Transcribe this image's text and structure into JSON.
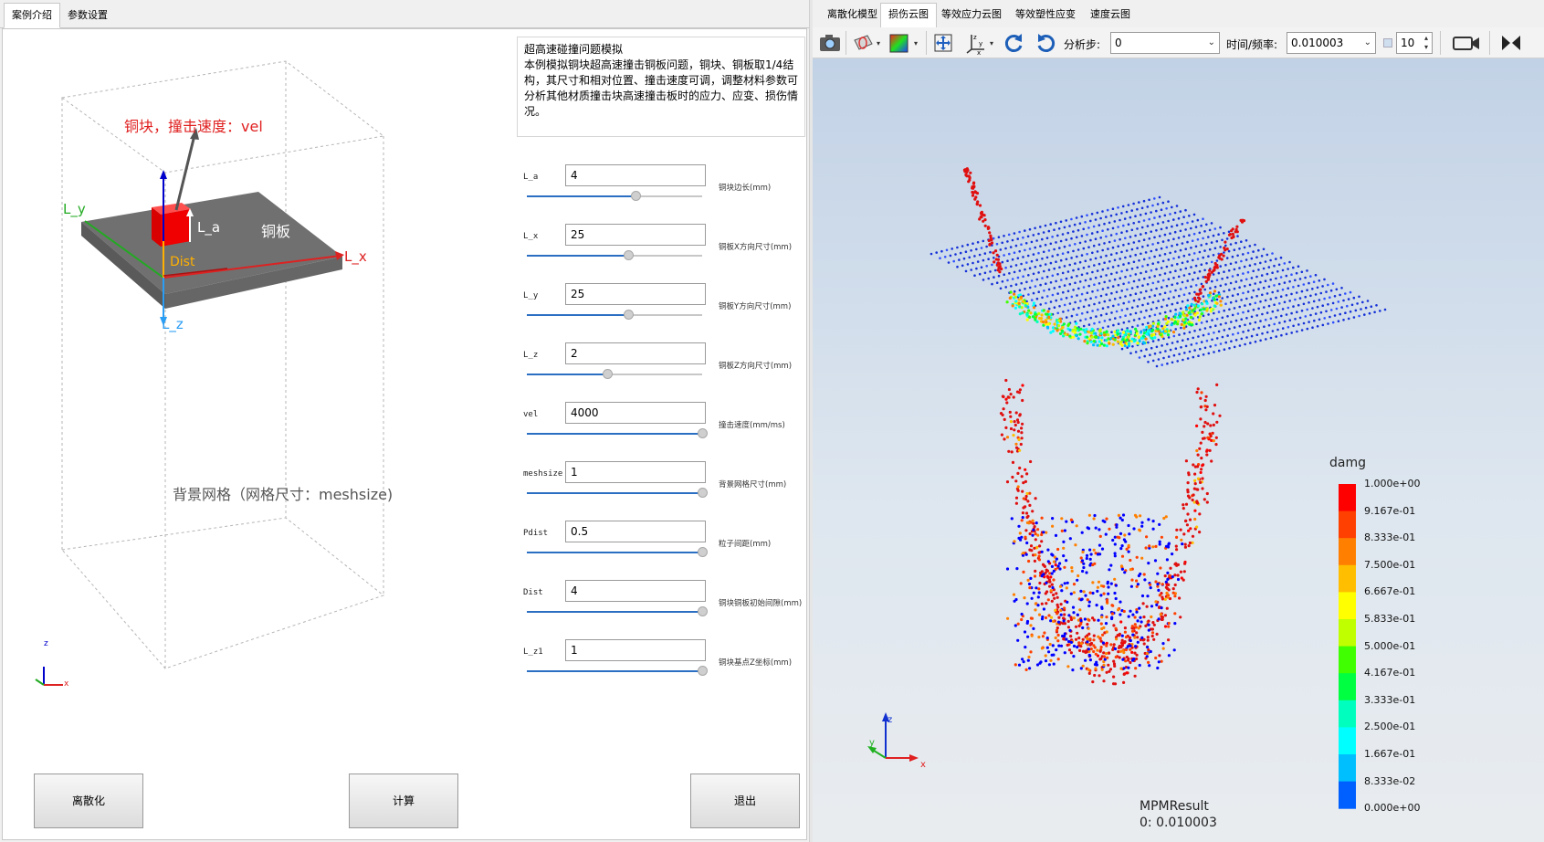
{
  "left_tabs": [
    {
      "label": "案例介绍",
      "active": true
    },
    {
      "label": "参数设置",
      "active": false
    }
  ],
  "schematic": {
    "velocity_label": "铜块，撞击速度：vel",
    "label_ly": "L_y",
    "label_lx": "L_x",
    "label_lz": "L_z",
    "label_la": "L_a",
    "label_dist": "Dist",
    "plate_label": "铜板",
    "mesh_label": "背景网格（网格尺寸：meshsize)",
    "axis_z": "z",
    "axis_x": "x",
    "axis_y": "y"
  },
  "description": {
    "title": "超高速碰撞问题模拟",
    "body": "本例模拟铜块超高速撞击铜板问题，铜块、铜板取1/4结构，其尺寸和相对位置、撞击速度可调，调整材料参数可分析其他材质撞击块高速撞击板时的应力、应变、损伤情况。"
  },
  "params": [
    {
      "name": "L_a",
      "value": "4",
      "unit": "铜块边长(mm)",
      "slider": 0.62
    },
    {
      "name": "L_x",
      "value": "25",
      "unit": "铜板X方向尺寸(mm)",
      "slider": 0.58
    },
    {
      "name": "L_y",
      "value": "25",
      "unit": "铜板Y方向尺寸(mm)",
      "slider": 0.58
    },
    {
      "name": "L_z",
      "value": "2",
      "unit": "铜板Z方向尺寸(mm)",
      "slider": 0.46
    },
    {
      "name": "vel",
      "value": "4000",
      "unit": "撞击速度(mm/ms)",
      "slider": 1.0
    },
    {
      "name": "meshsize",
      "value": "1",
      "unit": "背景网格尺寸(mm)",
      "slider": 1.0
    },
    {
      "name": "Pdist",
      "value": "0.5",
      "unit": "粒子间距(mm)",
      "slider": 1.0
    },
    {
      "name": "Dist",
      "value": "4",
      "unit": "铜块铜板初始间隙(mm)",
      "slider": 1.0
    },
    {
      "name": "L_z1",
      "value": "1",
      "unit": "铜块基点Z坐标(mm)",
      "slider": 1.0
    }
  ],
  "buttons": {
    "discretize": "离散化",
    "compute": "计算",
    "exit": "退出"
  },
  "right_tabs": [
    {
      "label": "离散化模型",
      "active": false
    },
    {
      "label": "损伤云图",
      "active": true
    },
    {
      "label": "等效应力云图",
      "active": false
    },
    {
      "label": "等效塑性应变",
      "active": false
    },
    {
      "label": "速度云图",
      "active": false
    }
  ],
  "toolbar": {
    "step_label": "分析步:",
    "step_value": "0",
    "time_label": "时间/频率:",
    "time_value": "0.010003",
    "frame_value": "10"
  },
  "legend": {
    "title": "damg",
    "labels": [
      "1.000e+00",
      "9.167e-01",
      "8.333e-01",
      "7.500e-01",
      "6.667e-01",
      "5.833e-01",
      "5.000e-01",
      "4.167e-01",
      "3.333e-01",
      "2.500e-01",
      "1.667e-01",
      "8.333e-02",
      "0.000e+00"
    ],
    "colors": [
      "#ff0000",
      "#ff4000",
      "#ff8000",
      "#ffbf00",
      "#ffff00",
      "#bfff00",
      "#40ff00",
      "#00ff40",
      "#00ffbf",
      "#00ffff",
      "#00bfff",
      "#0060ff",
      "#0000ff"
    ]
  },
  "result": {
    "name": "MPMResult",
    "time": "0: 0.010003"
  },
  "colors": {
    "accent": "#2b6fc2",
    "plate_particles": "#1530d8",
    "impact_high": "#e01010"
  }
}
